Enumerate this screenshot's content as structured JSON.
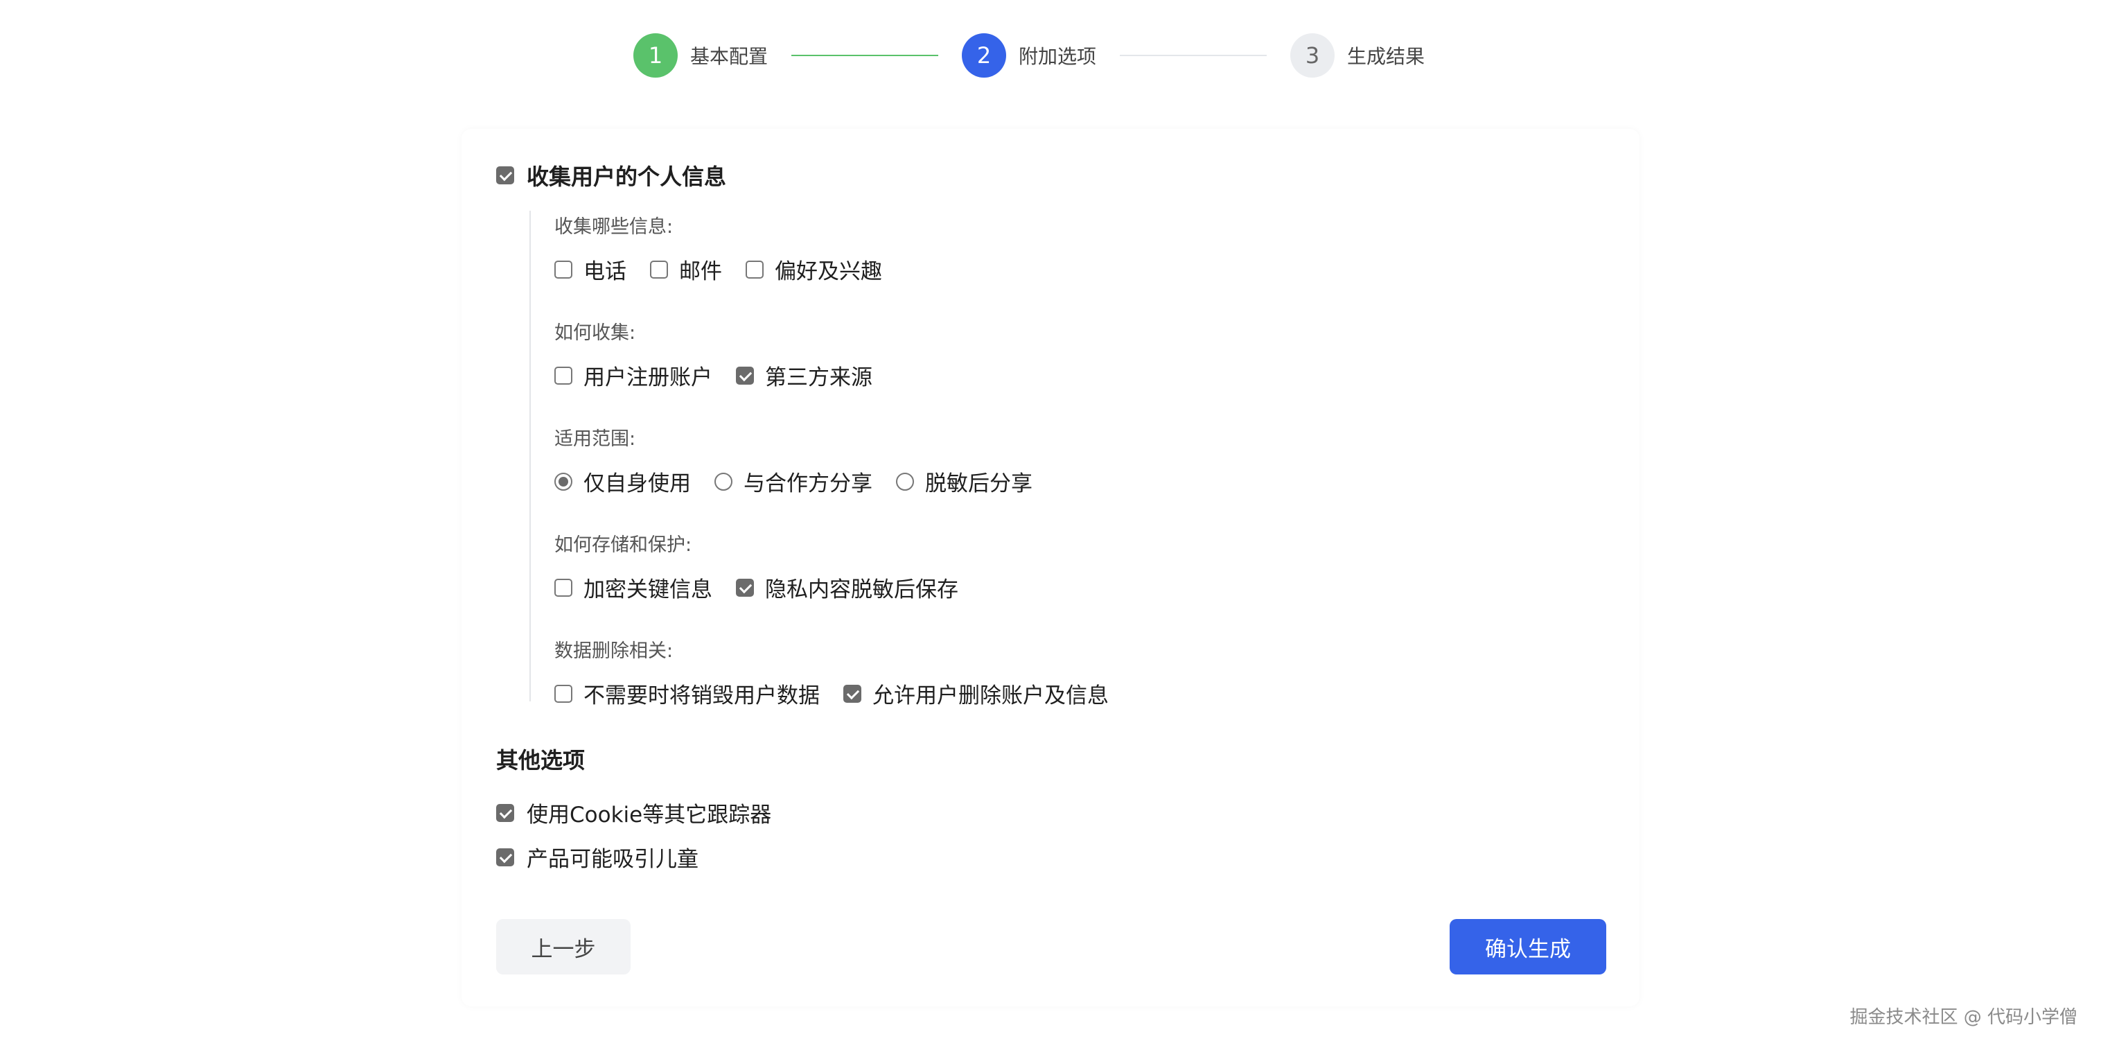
{
  "stepper": {
    "steps": [
      {
        "number": "1",
        "label": "基本配置",
        "state": "done"
      },
      {
        "number": "2",
        "label": "附加选项",
        "state": "active"
      },
      {
        "number": "3",
        "label": "生成结果",
        "state": "pending"
      }
    ]
  },
  "collect_personal_info": {
    "label": "收集用户的个人信息",
    "checked": true
  },
  "groups": [
    {
      "title": "收集哪些信息:",
      "type": "checkbox",
      "options": [
        {
          "label": "电话",
          "checked": false
        },
        {
          "label": "邮件",
          "checked": false
        },
        {
          "label": "偏好及兴趣",
          "checked": false
        }
      ]
    },
    {
      "title": "如何收集:",
      "type": "checkbox",
      "options": [
        {
          "label": "用户注册账户",
          "checked": false
        },
        {
          "label": "第三方来源",
          "checked": true
        }
      ]
    },
    {
      "title": "适用范围:",
      "type": "radio",
      "options": [
        {
          "label": "仅自身使用",
          "checked": true
        },
        {
          "label": "与合作方分享",
          "checked": false
        },
        {
          "label": "脱敏后分享",
          "checked": false
        }
      ]
    },
    {
      "title": "如何存储和保护:",
      "type": "checkbox",
      "options": [
        {
          "label": "加密关键信息",
          "checked": false
        },
        {
          "label": "隐私内容脱敏后保存",
          "checked": true
        }
      ]
    },
    {
      "title": "数据删除相关:",
      "type": "checkbox",
      "options": [
        {
          "label": "不需要时将销毁用户数据",
          "checked": false
        },
        {
          "label": "允许用户删除账户及信息",
          "checked": true
        }
      ]
    }
  ],
  "other": {
    "title": "其他选项",
    "options": [
      {
        "label": "使用Cookie等其它跟踪器",
        "checked": true
      },
      {
        "label": "产品可能吸引儿童",
        "checked": true
      }
    ]
  },
  "buttons": {
    "prev": "上一步",
    "confirm": "确认生成"
  },
  "colors": {
    "primary": "#3563e9",
    "success": "#5ac26b",
    "checked_fill": "#6b6b6b"
  },
  "watermark": "掘金技术社区 @ 代码小学僧"
}
